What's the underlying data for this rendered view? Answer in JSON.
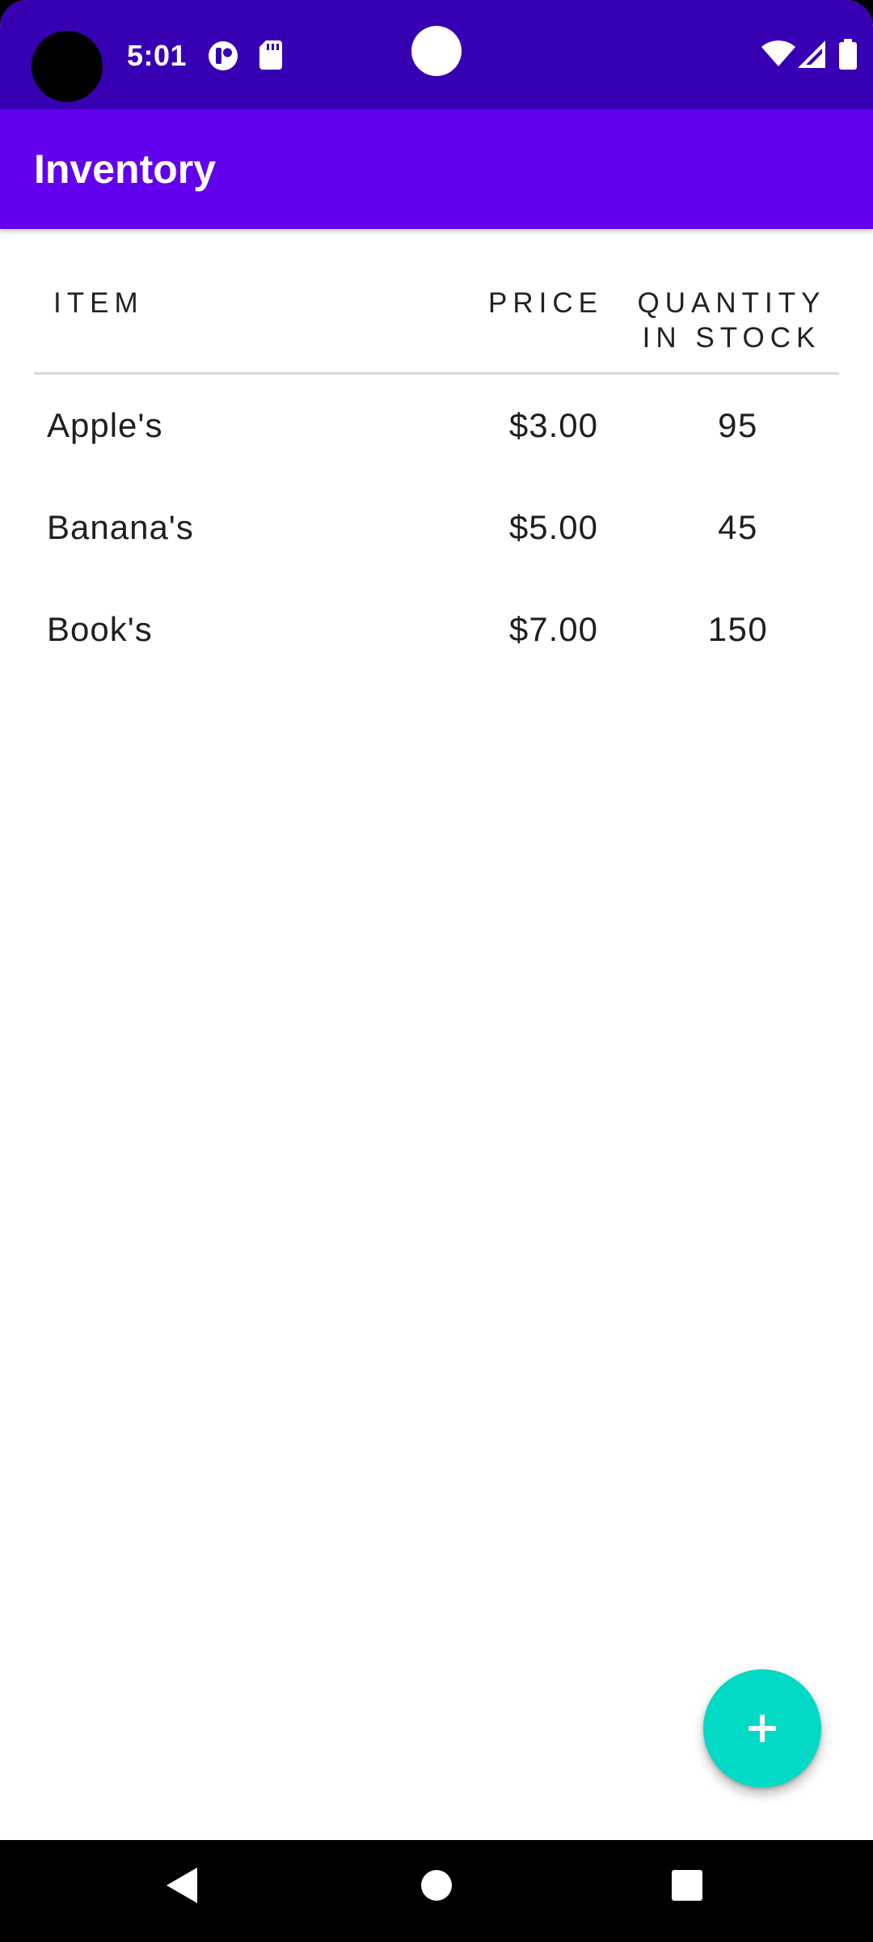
{
  "status_bar": {
    "time": "5:01",
    "icons": [
      "camera-cutout-icon",
      "app-notification-icon",
      "sd-card-icon",
      "notification-dot-icon",
      "wifi-icon",
      "cellular-signal-icon",
      "battery-icon"
    ],
    "color": "#3700B3"
  },
  "app_bar": {
    "title": "Inventory",
    "color": "#6200EE"
  },
  "table": {
    "headers": {
      "item": "ITEM",
      "price": "PRICE",
      "quantity_line1": "QUANTITY",
      "quantity_line2": "IN STOCK"
    },
    "rows": [
      {
        "item": "Apple's",
        "price": "$3.00",
        "quantity": "95"
      },
      {
        "item": "Banana's",
        "price": "$5.00",
        "quantity": "45"
      },
      {
        "item": "Book's",
        "price": "$7.00",
        "quantity": "150"
      }
    ]
  },
  "fab": {
    "icon": "plus-icon",
    "color": "#03DAC5"
  },
  "navigation_bar": {
    "icons": [
      "back-icon",
      "home-icon",
      "recents-icon"
    ]
  }
}
